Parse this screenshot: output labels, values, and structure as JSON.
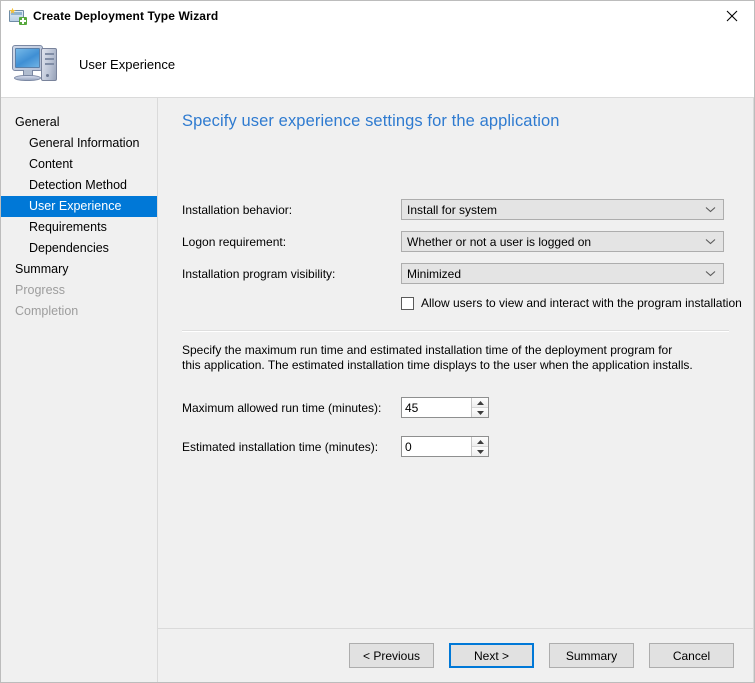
{
  "window": {
    "title": "Create Deployment Type Wizard",
    "title_icon": "wizard-icon",
    "close_label": "✕"
  },
  "banner": {
    "icon": "computer-icon",
    "heading": "User Experience"
  },
  "sidebar": {
    "items": [
      {
        "label": "General",
        "level": 0,
        "state": "normal"
      },
      {
        "label": "General Information",
        "level": 1,
        "state": "normal"
      },
      {
        "label": "Content",
        "level": 1,
        "state": "normal"
      },
      {
        "label": "Detection Method",
        "level": 1,
        "state": "normal"
      },
      {
        "label": "User Experience",
        "level": 1,
        "state": "selected"
      },
      {
        "label": "Requirements",
        "level": 1,
        "state": "normal"
      },
      {
        "label": "Dependencies",
        "level": 1,
        "state": "normal"
      },
      {
        "label": "Summary",
        "level": 0,
        "state": "normal"
      },
      {
        "label": "Progress",
        "level": 0,
        "state": "disabled"
      },
      {
        "label": "Completion",
        "level": 0,
        "state": "disabled"
      }
    ]
  },
  "content": {
    "page_title": "Specify user experience settings for the application",
    "fields": [
      {
        "label": "Installation behavior:",
        "value": "Install for system"
      },
      {
        "label": "Logon requirement:",
        "value": "Whether or not a user is logged on"
      },
      {
        "label": "Installation program visibility:",
        "value": "Minimized"
      }
    ],
    "checkbox": {
      "label": "Allow users to view and interact with the program installation",
      "checked": false
    },
    "description": "Specify the maximum run time and estimated installation time of the deployment program for this application. The estimated installation time displays to the user when the application installs.",
    "spinners": [
      {
        "label": "Maximum allowed run time (minutes):",
        "value": "45"
      },
      {
        "label": "Estimated installation time (minutes):",
        "value": "0"
      }
    ]
  },
  "footer": {
    "buttons": [
      {
        "label": "< Previous",
        "default": false
      },
      {
        "label": "Next >",
        "default": true
      },
      {
        "label": "Summary",
        "default": false
      },
      {
        "label": "Cancel",
        "default": false
      }
    ]
  },
  "colors": {
    "accent": "#0078d7",
    "title_blue": "#2f7bd0",
    "body_bg": "#f0f0f0"
  }
}
